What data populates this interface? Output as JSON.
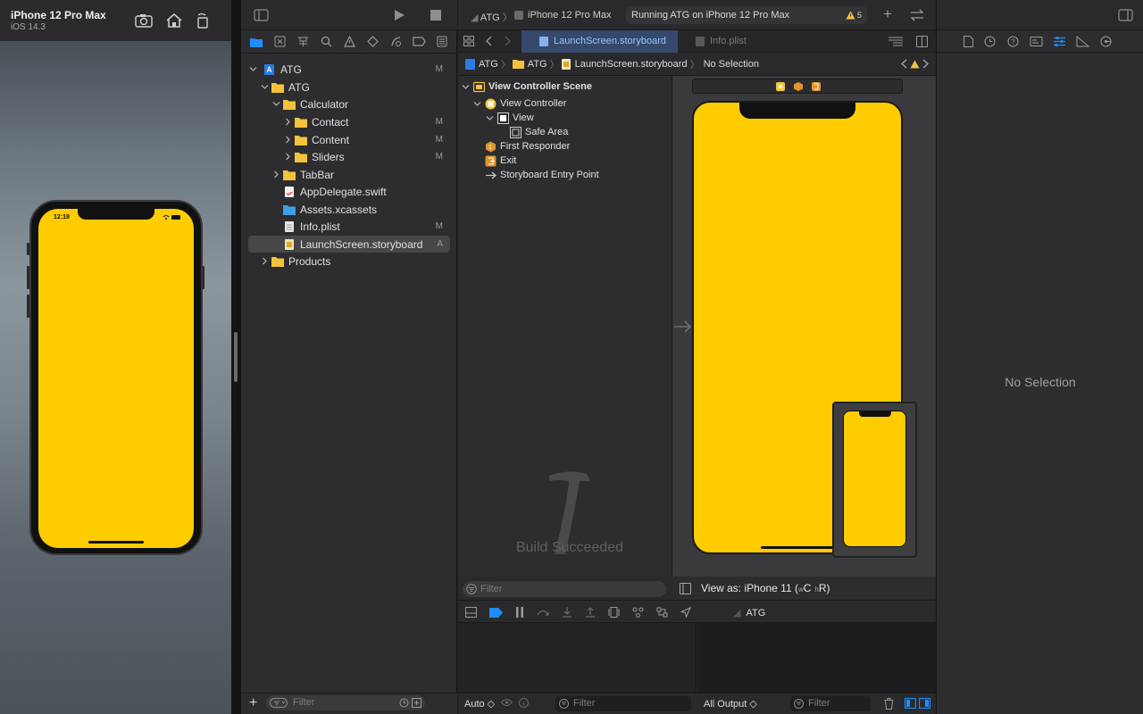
{
  "simulator": {
    "device": "iPhone 12 Pro Max",
    "os": "iOS 14.3",
    "time": "12:18",
    "screen_color": "#ffcc00"
  },
  "navigator": {
    "tree": [
      {
        "label": "ATG",
        "badge": "M",
        "icon": "project-icon"
      },
      {
        "label": "ATG",
        "badge": "",
        "icon": "folder-icon"
      },
      {
        "label": "Calculator",
        "badge": "",
        "icon": "folder-icon"
      },
      {
        "label": "Contact",
        "badge": "M",
        "icon": "folder-icon"
      },
      {
        "label": "Content",
        "badge": "M",
        "icon": "folder-icon"
      },
      {
        "label": "Sliders",
        "badge": "M",
        "icon": "folder-icon"
      },
      {
        "label": "TabBar",
        "badge": "",
        "icon": "folder-icon"
      },
      {
        "label": "AppDelegate.swift",
        "badge": "",
        "icon": "swift-file-icon"
      },
      {
        "label": "Assets.xcassets",
        "badge": "",
        "icon": "asset-catalog-icon"
      },
      {
        "label": "Info.plist",
        "badge": "M",
        "icon": "plist-icon"
      },
      {
        "label": "LaunchScreen.storyboard",
        "badge": "A",
        "icon": "storyboard-icon"
      },
      {
        "label": "Products",
        "badge": "",
        "icon": "folder-icon"
      }
    ],
    "filter_placeholder": "Filter"
  },
  "toolbar": {
    "scheme": "ATG",
    "destination": "iPhone 12 Pro Max",
    "status": "Running ATG on iPhone 12 Pro Max",
    "warnings": "5"
  },
  "tabs": [
    {
      "label": "LaunchScreen.storyboard",
      "active": true
    },
    {
      "label": "Info.plist",
      "active": false
    }
  ],
  "breadcrumb": [
    "ATG",
    "ATG",
    "LaunchScreen.storyboard",
    "No Selection"
  ],
  "outline": {
    "scene": "View Controller Scene",
    "items": [
      "View Controller",
      "View",
      "Safe Area",
      "First Responder",
      "Exit",
      "Storyboard Entry Point"
    ],
    "filter_placeholder": "Filter"
  },
  "canvas": {
    "view_as": "View as: iPhone 11 (",
    "size_w": "w",
    "size_c": "C",
    "size_h": "h",
    "size_r": "R)",
    "build_status": "Build Succeeded"
  },
  "debug": {
    "target": "ATG",
    "auto_label": "Auto ◇",
    "output_label": "All Output ◇",
    "filter_placeholder": "Filter"
  },
  "inspector": {
    "empty_label": "No Selection"
  }
}
